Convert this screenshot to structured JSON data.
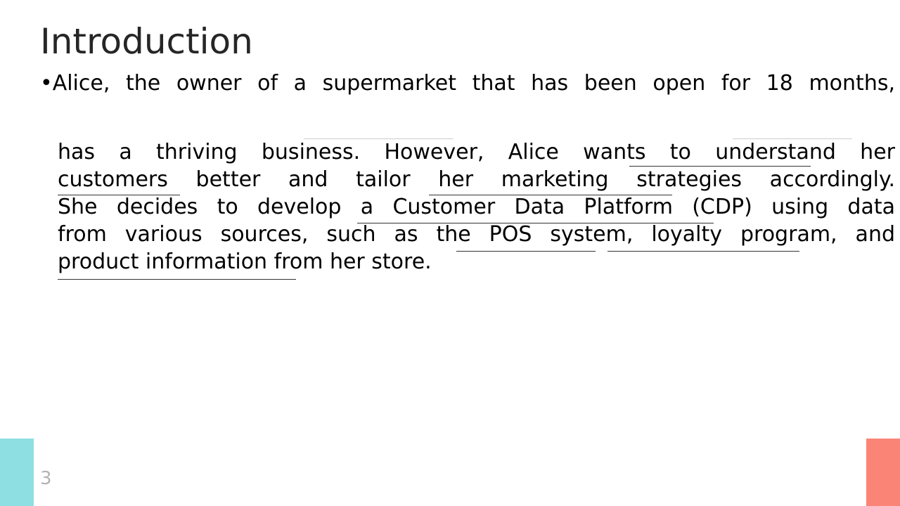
{
  "slide": {
    "title": "Introduction",
    "bullet_first_line": "•Alice, the owner of a supermarket that has been open for 18 months,",
    "body_lines": [
      "has a thriving business. However, Alice wants to understand her",
      "customers better and tailor her marketing strategies accordingly.",
      "She decides to develop a Customer Data Platform (CDP) using data",
      "from various sources, such as the POS system, loyalty program, and",
      "product information from her store."
    ],
    "page_number": "3"
  },
  "colors": {
    "title": "#262626",
    "accent_left": "#8ddfe2",
    "accent_right": "#fa8577",
    "page_number": "#b3b3b3"
  }
}
